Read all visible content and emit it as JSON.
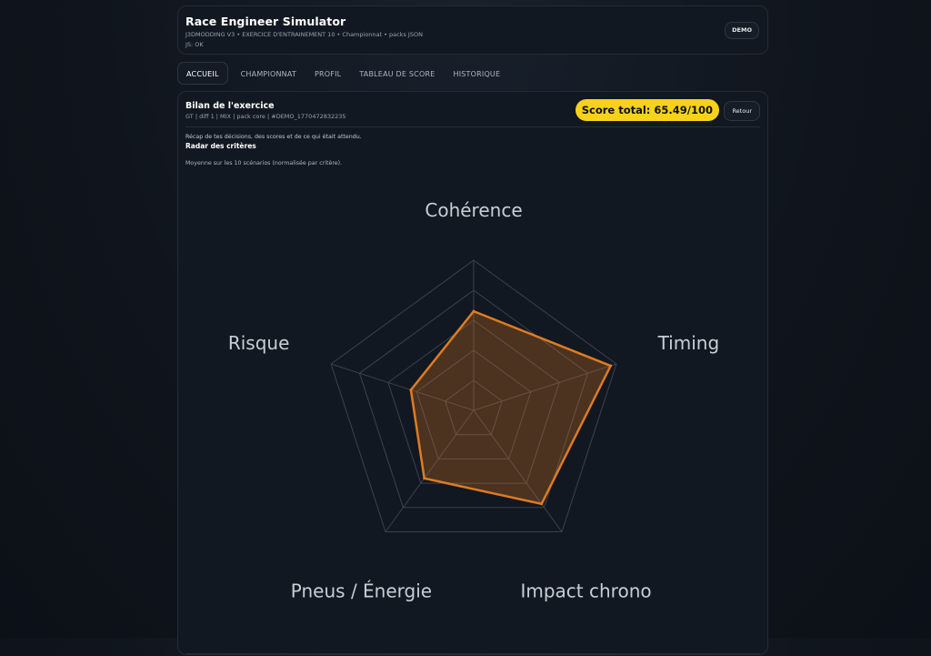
{
  "header": {
    "title": "Race Engineer Simulator",
    "subtitle": "J3DMODDING V3 • EXERCICE D'ENTRAINEMENT 10 • Championnat • packs JSON",
    "js_status": "JS: OK",
    "badge": "DEMO"
  },
  "tabs": [
    {
      "label": "ACCUEIL",
      "active": true
    },
    {
      "label": "CHAMPIONNAT",
      "active": false
    },
    {
      "label": "PROFIL",
      "active": false
    },
    {
      "label": "TABLEAU DE SCORE",
      "active": false
    },
    {
      "label": "HISTORIQUE",
      "active": false
    }
  ],
  "panel": {
    "title": "Bilan de l'exercice",
    "meta": "GT | diff 1 | MIX | pack core | #DEMO_1770472832235",
    "score": "Score total: 65.49/100",
    "back_label": "Retour",
    "recap": "Récap de tes décisions, des scores et de ce qui était attendu.",
    "radar_title": "Radar des critères",
    "radar_note": "Moyenne sur les 10 scénarios (normalisée par critère)."
  },
  "colors": {
    "accent": "#f6d21a",
    "radar_stroke": "#e07b22",
    "radar_fill": "#e07b22",
    "grid": "#3a4250"
  },
  "chart_data": {
    "type": "radar",
    "axes": [
      "Cohérence",
      "Timing",
      "Impact chrono",
      "Pneus / Énergie",
      "Risque"
    ],
    "values": [
      0.66,
      0.96,
      0.77,
      0.56,
      0.44
    ],
    "range": [
      0,
      1
    ],
    "grid_levels": 5
  }
}
